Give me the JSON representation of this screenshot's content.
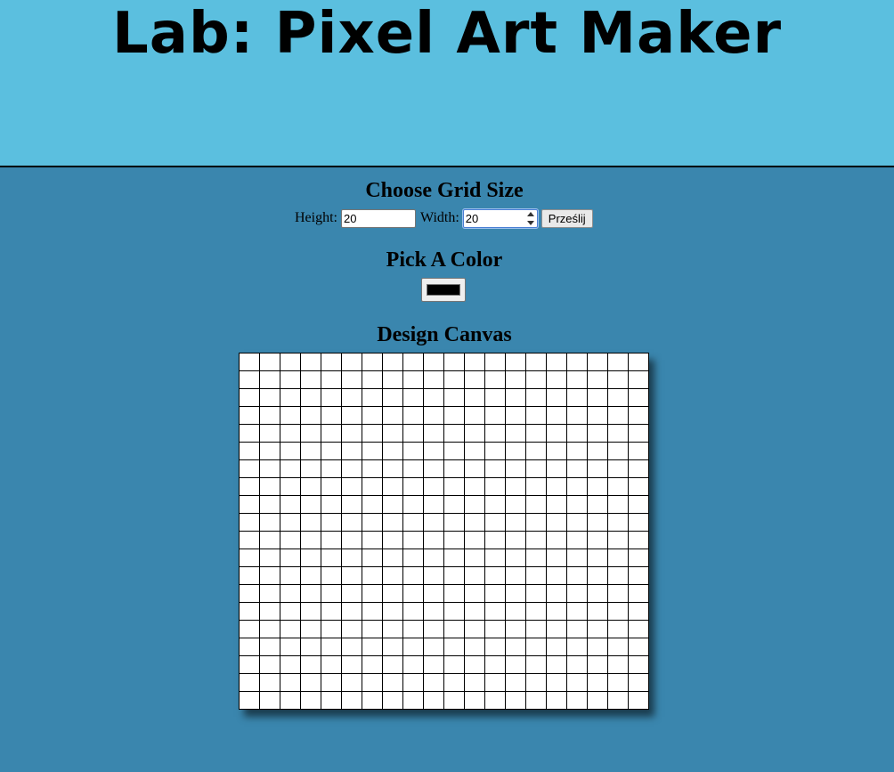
{
  "header": {
    "title": "Lab: Pixel Art Maker"
  },
  "grid_size": {
    "heading": "Choose Grid Size",
    "height_label": "Height:",
    "height_value": "20",
    "width_label": "Width:",
    "width_value": "20",
    "submit_label": "Prześlij"
  },
  "color": {
    "heading": "Pick A Color",
    "value": "#000000"
  },
  "canvas": {
    "heading": "Design Canvas",
    "rows": 20,
    "cols": 20
  },
  "colors": {
    "header_bg": "#5bbfdf",
    "page_bg": "#3a86ae",
    "cell_bg": "#ffffff"
  }
}
